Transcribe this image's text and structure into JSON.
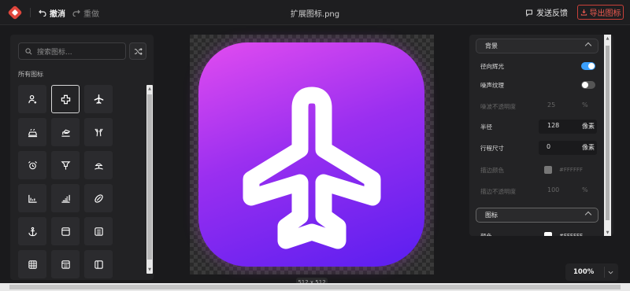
{
  "toolbar": {
    "undo_label": "撤消",
    "redo_label": "重做",
    "file_title": "扩展图标.png",
    "feedback_label": "发送反馈",
    "export_label": "导出图标"
  },
  "icon_library": {
    "search_placeholder": "搜索图标...",
    "section_title": "所有图标",
    "icons": [
      "engineer",
      "plus-cross",
      "plane",
      "car-travel",
      "airport-ticket",
      "cocktail",
      "alarm-clock",
      "location-pin",
      "beach-umbrella",
      "bar-chart-baseline",
      "bar-chart-horizontal",
      "rugby-ball",
      "anchor",
      "window-app",
      "calculator-card",
      "table-grid",
      "document-list",
      "sidebar-layout"
    ],
    "selected_icon": "plus-cross"
  },
  "canvas": {
    "icon_name": "plane",
    "size_label": "512 x 512",
    "gradient_colors": [
      "#e24cf0",
      "#5a1ef0"
    ]
  },
  "properties": {
    "background_section": "背景",
    "radial_glow_label": "径向辉光",
    "radial_glow_on": true,
    "noise_texture_label": "噪声纹理",
    "noise_texture_on": false,
    "noise_opacity_label": "噪波不透明度",
    "noise_opacity_value": "25",
    "noise_opacity_unit": "%",
    "radius_label": "半径",
    "radius_value": "128",
    "radius_unit": "像素",
    "stroke_size_label": "行程尺寸",
    "stroke_size_value": "0",
    "stroke_size_unit": "像素",
    "stroke_color_label": "描边颜色",
    "stroke_color_value": "#FFFFFF",
    "stroke_opacity_label": "描边不透明度",
    "stroke_opacity_value": "100",
    "stroke_opacity_unit": "%",
    "icon_section": "图标",
    "icon_color_label": "颜色",
    "icon_color_value": "#FFFFFF"
  },
  "zoom": {
    "value": "100%"
  }
}
